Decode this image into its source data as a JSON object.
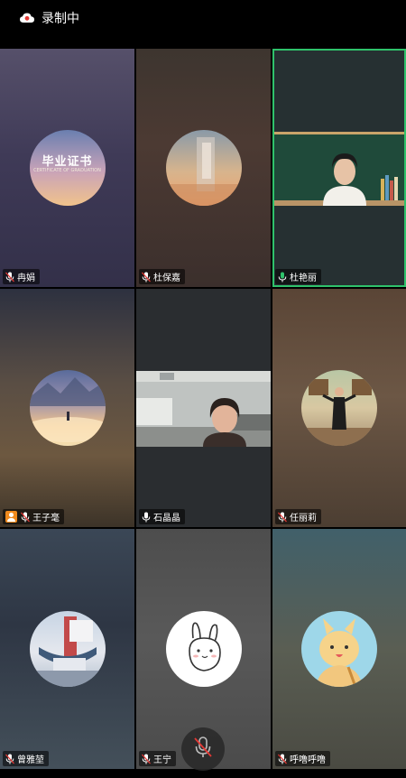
{
  "status": {
    "recording_label": "录制中"
  },
  "participants": [
    {
      "name": "冉娟",
      "avatar_text": "毕业证书",
      "avatar_sub": "CERTIFICATE OF GRADUATION",
      "mic": "muted"
    },
    {
      "name": "杜保嘉",
      "mic": "muted"
    },
    {
      "name": "杜艳丽",
      "mic": "active",
      "active_speaker": true
    },
    {
      "name": "王子毫",
      "mic": "muted",
      "host": true
    },
    {
      "name": "石晶晶",
      "mic": "on"
    },
    {
      "name": "任丽莉",
      "mic": "muted"
    },
    {
      "name": "曾雅堃",
      "mic": "muted"
    },
    {
      "name": "王宁",
      "mic": "muted"
    },
    {
      "name": "呼噜呼噜",
      "mic": "muted"
    }
  ],
  "colors": {
    "active_border": "#2fc26b",
    "host_badge": "#f08a1d",
    "recording_icon": "#ffffff"
  },
  "icons": {
    "recording": "cloud-record-icon",
    "mic_muted": "mic-muted-icon",
    "mic_on": "mic-icon",
    "host": "host-icon"
  }
}
